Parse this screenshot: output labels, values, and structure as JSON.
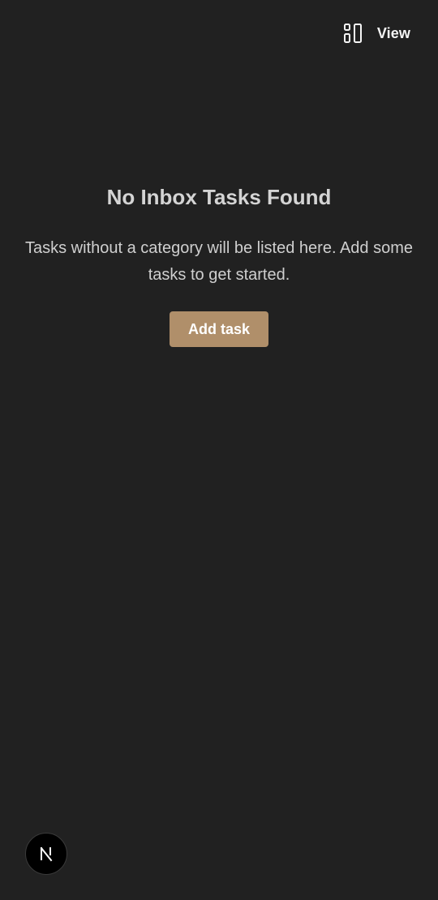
{
  "header": {
    "view_label": "View",
    "view_icon": "layout-columns-icon"
  },
  "empty_state": {
    "title": "No Inbox Tasks Found",
    "description": "Tasks without a category will be listed here. Add some tasks to get started.",
    "add_button_label": "Add task"
  },
  "dev_badge": {
    "icon": "nextjs-logo-icon"
  },
  "colors": {
    "background": "#212121",
    "accent": "#b08f6a",
    "title_text": "#d4d4d4",
    "body_text": "#cfcfcf"
  }
}
